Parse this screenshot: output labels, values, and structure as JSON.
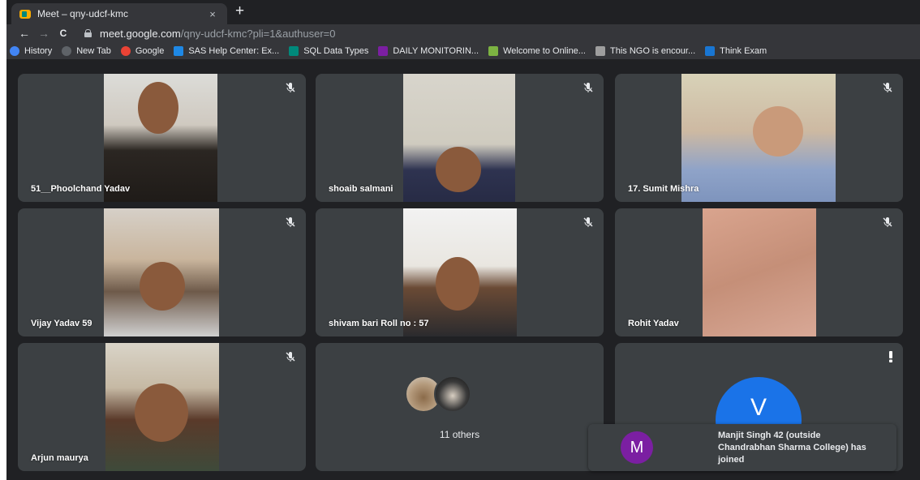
{
  "browser": {
    "tab_title": "Meet – qny-udcf-kmc",
    "tab_close": "×",
    "new_tab": "+",
    "url_host": "meet.google.com",
    "url_path": "/qny-udcf-kmc?pli=1&authuser=0",
    "back": "←",
    "forward": "→",
    "reload": "C",
    "bookmarks": [
      {
        "label": "History",
        "icon": "history-icon",
        "color": "#4285f4"
      },
      {
        "label": "New Tab",
        "icon": "globe-icon",
        "color": "#5f6368"
      },
      {
        "label": "Google",
        "icon": "google-icon",
        "color": "#ea4335"
      },
      {
        "label": "SAS Help Center: Ex...",
        "icon": "sas-icon",
        "color": "#1e88e5"
      },
      {
        "label": "SQL Data Types",
        "icon": "sql-icon",
        "color": "#00897b"
      },
      {
        "label": "DAILY MONITORIN...",
        "icon": "sheet-icon",
        "color": "#7b1fa2"
      },
      {
        "label": "Welcome to Online...",
        "icon": "leaf-icon",
        "color": "#7cb342"
      },
      {
        "label": "This NGO is encour...",
        "icon": "dna-icon",
        "color": "#9e9e9e"
      },
      {
        "label": "Think Exam",
        "icon": "puzzle-icon",
        "color": "#1976d2"
      }
    ]
  },
  "meet": {
    "tiles": [
      {
        "name": "51__Phoolchand Yadav"
      },
      {
        "name": "shoaib salmani"
      },
      {
        "name": "17. Sumit Mishra"
      },
      {
        "name": "Vijay Yadav 59"
      },
      {
        "name": "shivam bari Roll no : 57"
      },
      {
        "name": "Rohit Yadav"
      },
      {
        "name": "Arjun maurya"
      }
    ],
    "others_label": "11 others",
    "v_initial": "V",
    "toast": {
      "initial": "M",
      "message": "Manjit Singh 42 (outside Chandrabhan Sharma College) has joined"
    },
    "colors": {
      "tile_bg": "#3c4043",
      "grid_bg": "#202124",
      "v_avatar": "#1a73e8",
      "m_avatar": "#7b1fa2"
    }
  }
}
